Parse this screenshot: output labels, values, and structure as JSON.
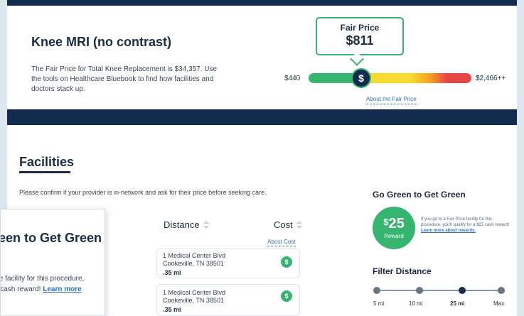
{
  "procedure": {
    "title": "Knee MRI (no contrast)",
    "description": "The Fair Price for Total Knee Replacement is $34,357. Use the tools on Healthcare Bluebook to find how facilities and doctors stack up."
  },
  "fair_price": {
    "label": "Fair Price",
    "value": "$811",
    "range_min": "$440",
    "range_max": "$2,466++",
    "marker_icon": "$",
    "about_link": "About the Fair Price",
    "colors": {
      "green": "#35b56f",
      "yellow": "#f7da2d",
      "red": "#e84646",
      "navy": "#132c4d"
    }
  },
  "facilities": {
    "title": "Facilities",
    "confirm_text": "Please confirm if your provider is in-network and ask for their price before seeking care.",
    "columns": {
      "distance": "Distance",
      "cost": "Cost"
    },
    "about_cost": "About Cost",
    "rows": [
      {
        "address_line1": "1 Medical Center Blvd",
        "address_line2": "Cookeville, TN 38501",
        "distance": ".35 mi",
        "cost_icon": "$"
      },
      {
        "address_line1": "1 Medical Center Blvd",
        "address_line2": "Cookeville, TN 38501",
        "distance": ".35 mi",
        "cost_icon": "$"
      }
    ]
  },
  "go_green": {
    "title": "Go Green to Get Green",
    "reward_currency": "$",
    "reward_amount": "25",
    "reward_label": "Reward",
    "desc_prefix": "If you go to a Fair Price facility for this procedure, you'll qualify for a $25 cash reward! ",
    "desc_link": "Learn more about rewards."
  },
  "filter_distance": {
    "title": "Filter Distance",
    "options": [
      "5 mi",
      "10 mi",
      "25 mi",
      "Max"
    ],
    "selected": "25 mi"
  },
  "popup": {
    "title": "Go Green to Get Green",
    "text_prefix": "If you go to a Fair Price facility for this procedure, you'll qualify for a $25 cash reward! ",
    "text_link": "Learn more about rewards."
  }
}
